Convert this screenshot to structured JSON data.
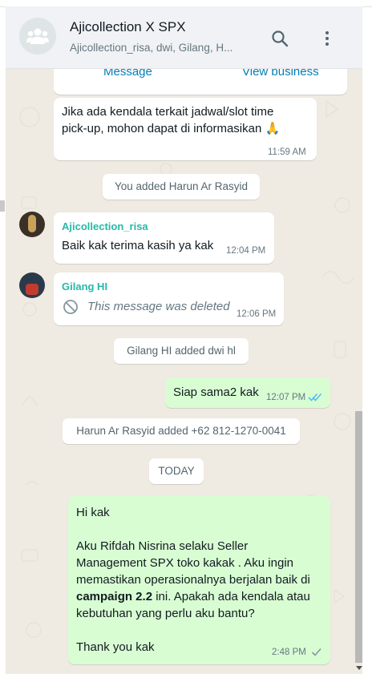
{
  "header": {
    "title": "Ajicollection X SPX",
    "subtitle": "Ajicollection_risa, dwi, Gilang, H..."
  },
  "top_card": {
    "message_link": "Message",
    "view_business_link": "View business"
  },
  "messages": [
    {
      "id": "m1",
      "text_line1": "Jika ada kendala terkait jadwal/slot time",
      "text_line2": "pick-up, mohon dapat di informasikan",
      "emoji": "🙏",
      "time": "11:59 AM"
    },
    {
      "id": "s1",
      "text": "You added Harun Ar Rasyid"
    },
    {
      "id": "m2",
      "sender": "Ajicollection_risa",
      "text": "Baik kak terima kasih ya kak",
      "time": "12:04 PM"
    },
    {
      "id": "m3",
      "sender": "Gilang HI",
      "deleted_text": "This message was deleted",
      "time": "12:06 PM"
    },
    {
      "id": "s2",
      "text": "Gilang HI added dwi hl"
    },
    {
      "id": "m4",
      "text": "Siap sama2 kak",
      "time": "12:07 PM"
    },
    {
      "id": "s3",
      "text": "Harun Ar Rasyid added +62 812-1270-0041"
    },
    {
      "id": "s4",
      "text": "TODAY"
    },
    {
      "id": "m5",
      "line1": "Hi kak",
      "line2": "Aku Rifdah Nisrina selaku Seller",
      "line3": "Management SPX toko kakak . Aku ingin",
      "line4": "memastikan operasionalnya berjalan baik di",
      "line5_bold": "campaign 2.2",
      "line5_rest": " ini. Apakah ada kendala atau",
      "line6": "kebutuhan yang perlu aku bantu?",
      "line7": "Thank you kak",
      "time": "2:48 PM"
    }
  ],
  "colors": {
    "chat_bg": "#efeae2",
    "outgoing": "#d9fdd3",
    "incoming": "#ffffff",
    "sender_name": "#25b9a8",
    "read_tick": "#53bdeb"
  },
  "icons": [
    "group-avatar-icon",
    "search-icon",
    "menu-dots-icon",
    "deleted-icon",
    "double-tick-icon",
    "single-tick-icon"
  ]
}
